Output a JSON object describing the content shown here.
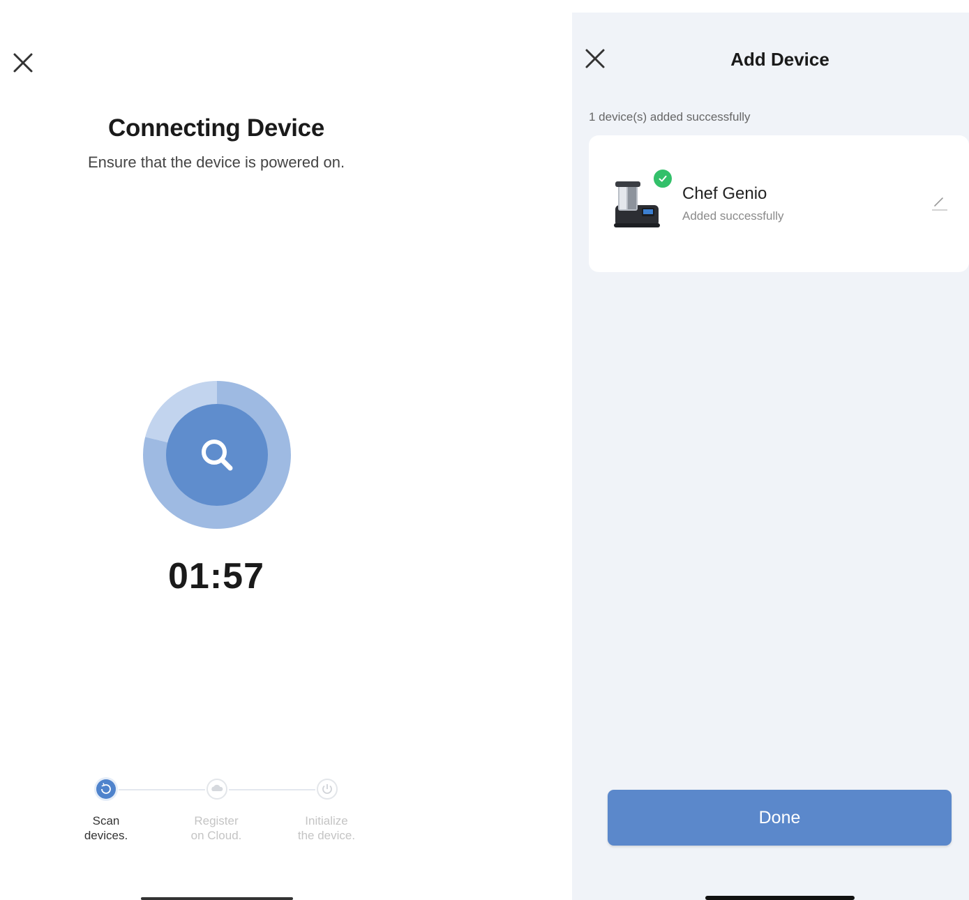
{
  "connecting_screen": {
    "title": "Connecting Device",
    "subtitle": "Ensure that the device is powered on.",
    "timer": "01:57",
    "scan_progress_fraction": 0.79,
    "steps": [
      {
        "label_line1": "Scan",
        "label_line2": "devices.",
        "state": "active",
        "icon": "refresh-icon"
      },
      {
        "label_line1": "Register",
        "label_line2": "on Cloud.",
        "state": "pending",
        "icon": "cloud-icon"
      },
      {
        "label_line1": "Initialize",
        "label_line2": "the device.",
        "state": "pending",
        "icon": "power-icon"
      }
    ],
    "colors": {
      "accent": "#5f8dcd",
      "ring": "#9ebae2",
      "ring_light": "#c2d4ee"
    }
  },
  "add_device_screen": {
    "title": "Add Device",
    "added_count_text": "1 device(s) added successfully",
    "device": {
      "name": "Chef Genio",
      "status": "Added successfully",
      "icon": "kitchen-robot-icon"
    },
    "done_label": "Done",
    "colors": {
      "background": "#f0f3f8",
      "button": "#5b88cb",
      "success": "#33c06a"
    }
  }
}
